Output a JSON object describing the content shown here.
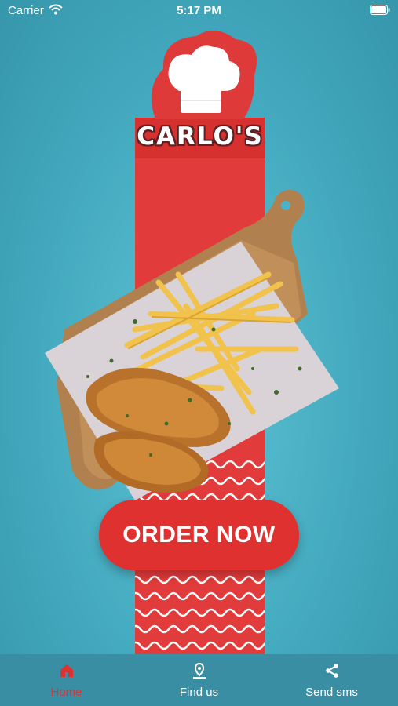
{
  "status_bar": {
    "carrier": "Carrier",
    "time": "5:17 PM"
  },
  "brand": {
    "name": "CARLO'S"
  },
  "actions": {
    "order_now": "ORDER NOW"
  },
  "tab_bar": {
    "items": [
      {
        "label": "Home",
        "icon": "home-icon",
        "active": true
      },
      {
        "label": "Find us",
        "icon": "location-pin-icon",
        "active": false
      },
      {
        "label": "Send sms",
        "icon": "share-icon",
        "active": false
      }
    ]
  },
  "colors": {
    "brand_red": "#e03131",
    "background": "#4bb3c8",
    "tab_bar": "#3a8ea4"
  }
}
